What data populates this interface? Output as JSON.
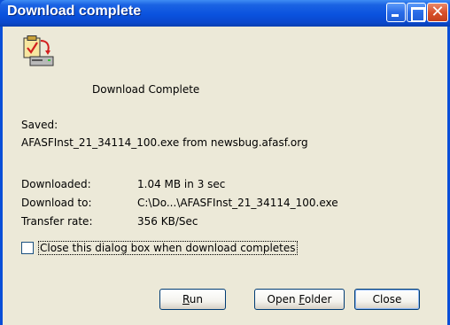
{
  "window": {
    "title": "Download complete"
  },
  "icons": {
    "download": "download-complete-icon",
    "minimize": "minimize-icon",
    "maximize": "maximize-icon",
    "close": "close-icon"
  },
  "body": {
    "headline": "Download Complete",
    "saved_label": "Saved:",
    "saved_value": "AFASFInst_21_34114_100.exe from newsbug.afasf.org",
    "downloaded_label": "Downloaded:",
    "downloaded_value": "1.04 MB in 3 sec",
    "download_to_label": "Download to:",
    "download_to_value": "C:\\Do...\\AFASFInst_21_34114_100.exe",
    "transfer_rate_label": "Transfer rate:",
    "transfer_rate_value": "356 KB/Sec",
    "close_when_done_label": "Close this dialog box when download completes",
    "close_when_done_checked": false
  },
  "buttons": {
    "run_mnemonic": "R",
    "run_rest": "un",
    "open_folder_pre": "Open ",
    "open_folder_mnemonic": "F",
    "open_folder_rest": "older",
    "close": "Close"
  },
  "colors": {
    "titlebar": "#0a52de",
    "dialog_bg": "#ece9d8",
    "close_button": "#d9512c"
  }
}
